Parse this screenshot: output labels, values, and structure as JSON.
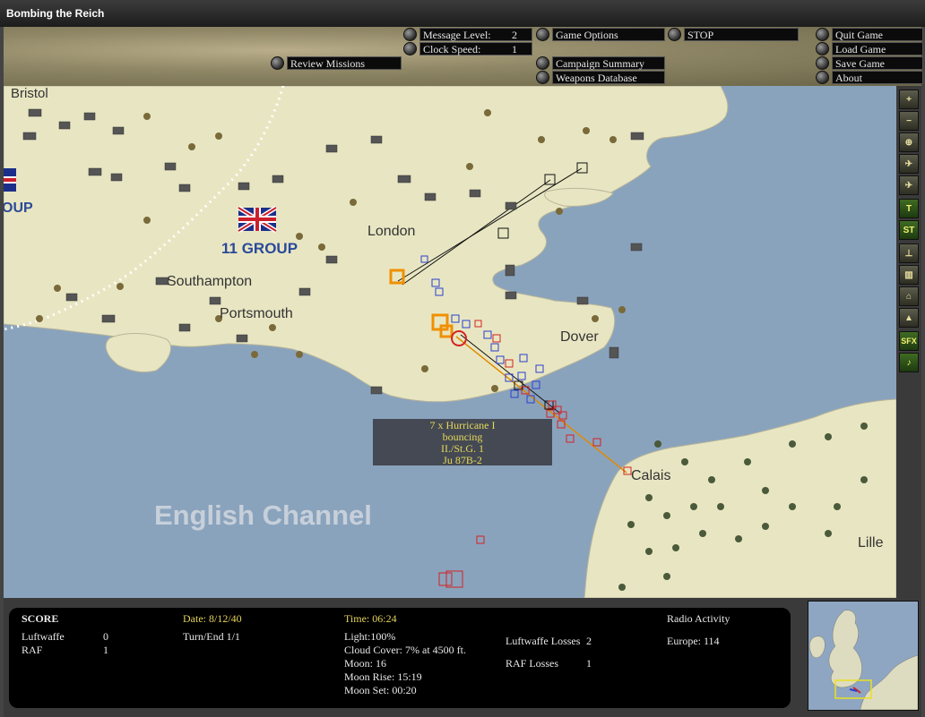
{
  "window": {
    "title": "Bombing the Reich"
  },
  "top_controls": {
    "review_missions": "Review Missions",
    "message_level_label": "Message Level:",
    "message_level_value": "2",
    "clock_speed_label": "Clock Speed:",
    "clock_speed_value": "1",
    "game_options": "Game Options",
    "campaign_summary": "Campaign Summary",
    "weapons_database": "Weapons Database",
    "stop": "STOP",
    "quit_game": "Quit Game",
    "load_game": "Load Game",
    "save_game": "Save Game",
    "about": "About"
  },
  "sidebar": {
    "buttons": [
      {
        "name": "zoom-in",
        "glyph": "+"
      },
      {
        "name": "zoom-out",
        "glyph": "−"
      },
      {
        "name": "center",
        "glyph": "⊕"
      },
      {
        "name": "air-groups",
        "glyph": "✈"
      },
      {
        "name": "aircraft",
        "glyph": "✈"
      },
      {
        "name": "targets",
        "glyph": "T"
      },
      {
        "name": "strategic",
        "glyph": "ST"
      },
      {
        "name": "airfields",
        "glyph": "⊥"
      },
      {
        "name": "factories",
        "glyph": "▥"
      },
      {
        "name": "cities",
        "glyph": "⌂"
      },
      {
        "name": "terrain",
        "glyph": "▲"
      },
      {
        "name": "sound-effects",
        "glyph": "SFX"
      },
      {
        "name": "music",
        "glyph": "♪"
      }
    ]
  },
  "map": {
    "labels": {
      "bristol": "Bristol",
      "group_left": "OUP",
      "group_11": "11 GROUP",
      "southampton": "Southampton",
      "portsmouth": "Portsmouth",
      "london": "London",
      "dover": "Dover",
      "calais": "Calais",
      "english_channel": "English Channel",
      "lille": "Lille"
    },
    "tooltip": {
      "line1": "7 x Hurricane I",
      "line2": "bouncing",
      "line3": "II./St.G. 1",
      "line4": "Ju 87B-2"
    }
  },
  "info": {
    "score_label": "SCORE",
    "luftwaffe_label": "Luftwaffe",
    "luftwaffe_score": "0",
    "raf_label": "RAF",
    "raf_score": "1",
    "date": "Date: 8/12/40",
    "turn": "Turn/End 1/1",
    "time": "Time: 06:24",
    "light": "Light:100%",
    "cloud_cover": "Cloud Cover: 7% at 4500 ft.",
    "moon": "Moon: 16",
    "moon_rise": "Moon Rise: 15:19",
    "moon_set": "Moon Set: 00:20",
    "luftwaffe_losses_label": "Luftwaffe Losses",
    "luftwaffe_losses_value": "2",
    "raf_losses_label": "RAF Losses",
    "raf_losses_value": "1",
    "radio_activity_label": "Radio Activity",
    "europe_activity": "Europe: 114"
  },
  "colors": {
    "sea": "#8aa3bd",
    "land": "#e8e6c2",
    "raf_marker": "#2a3fd0",
    "luftwaffe_marker": "#d42222",
    "selected_marker": "#f09000",
    "tooltip_text": "#e6d95a"
  }
}
